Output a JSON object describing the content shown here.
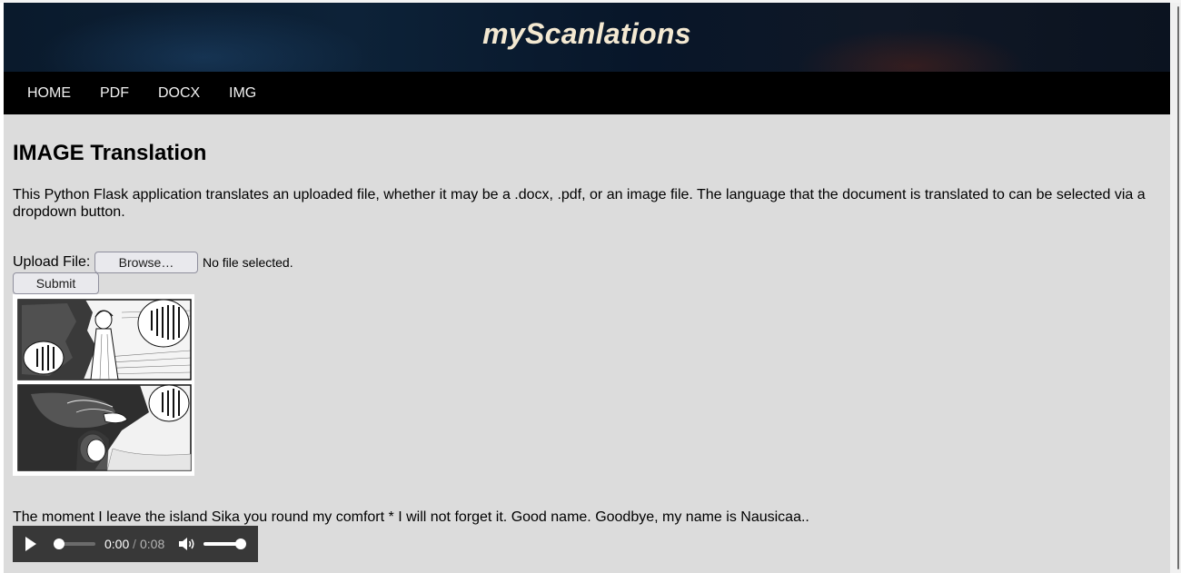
{
  "site": {
    "title": "myScanlations"
  },
  "nav": {
    "items": [
      {
        "label": "HOME"
      },
      {
        "label": "PDF"
      },
      {
        "label": "DOCX"
      },
      {
        "label": "IMG"
      }
    ]
  },
  "main": {
    "heading": "IMAGE Translation",
    "description": "This Python Flask application translates an uploaded file, whether it may be a .docx, .pdf, or an image file. The language that the document is translated to can be selected via a dropdown button.",
    "upload_label": "Upload File:",
    "browse_label": "Browse…",
    "no_file_text": "No file selected.",
    "submit_label": "Submit",
    "translation_text": "The moment I leave the island Sika you round my comfort * I will not forget it. Good name. Goodbye, my name is Nausicaa.."
  },
  "audio": {
    "current_time": "0:00",
    "separator": "/",
    "duration": "0:08",
    "progress": 0,
    "volume": 1.0
  },
  "colors": {
    "page_background": "#dcdcdc",
    "navbar": "#000000",
    "title": "#f4e9d2",
    "audio_player": "#383838"
  },
  "icons": {
    "play": "play-icon",
    "volume": "volume-icon"
  }
}
